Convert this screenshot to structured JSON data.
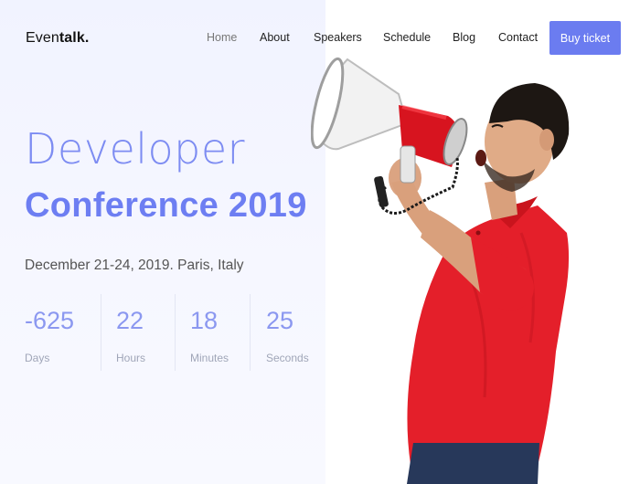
{
  "header": {
    "logo_light": "Even",
    "logo_bold": "talk.",
    "nav": [
      {
        "label": "Home",
        "active": true
      },
      {
        "label": "About",
        "active": false
      },
      {
        "label": "Speakers",
        "active": false
      },
      {
        "label": "Schedule",
        "active": false
      },
      {
        "label": "Blog",
        "active": false
      },
      {
        "label": "Contact",
        "active": false
      }
    ],
    "cta_label": "Buy ticket"
  },
  "hero": {
    "title_line1": "Developer",
    "title_line2": "Conference 2019",
    "meta": "December 21-24, 2019. Paris, Italy"
  },
  "countdown": [
    {
      "value": "-625",
      "label": "Days"
    },
    {
      "value": "22",
      "label": "Hours"
    },
    {
      "value": "18",
      "label": "Minutes"
    },
    {
      "value": "25",
      "label": "Seconds"
    }
  ],
  "colors": {
    "accent": "#6b7cf0",
    "panel_bg": "#f3f5ff",
    "shirt": "#e41f2a",
    "megaphone_red": "#d7141f"
  }
}
